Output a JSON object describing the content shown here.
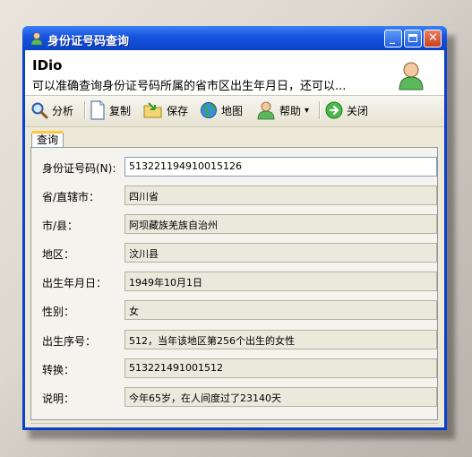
{
  "window": {
    "title": "身份证号码查询",
    "minimize_glyph": "_",
    "close_glyph": "✕"
  },
  "header": {
    "app_name": "IDio",
    "description": "可以准确查询身份证号码所属的省市区出生年月日，还可以..."
  },
  "toolbar": {
    "analyze": "分析",
    "copy": "复制",
    "save": "保存",
    "map": "地图",
    "help": "帮助",
    "help_arrow": "▾",
    "close": "关闭"
  },
  "tabs": [
    {
      "label": "查询",
      "active": true
    }
  ],
  "form": {
    "id_number": {
      "label": "身份证号码(N):",
      "value": "513221194910015126"
    },
    "province": {
      "label": "省/直辖市：",
      "value": "四川省"
    },
    "city": {
      "label": "市/县：",
      "value": "阿坝藏族羌族自治州"
    },
    "district": {
      "label": "地区：",
      "value": "汶川县"
    },
    "birthdate": {
      "label": "出生年月日：",
      "value": "1949年10月1日"
    },
    "gender": {
      "label": "性别：",
      "value": "女"
    },
    "sequence": {
      "label": "出生序号：",
      "value": "512，当年该地区第256个出生的女性"
    },
    "convert": {
      "label": "转换：",
      "value": "513221491001512"
    },
    "note": {
      "label": "说明：",
      "value": "今年65岁，在人间度过了23140天"
    }
  },
  "colors": {
    "titlebar": "#1653de",
    "client": "#ece9d8",
    "accent_tab": "#ffc83c"
  },
  "icons": [
    "user-icon",
    "magnifier-icon",
    "document-icon",
    "save-folder-icon",
    "globe-icon",
    "help-user-icon",
    "exit-icon"
  ]
}
